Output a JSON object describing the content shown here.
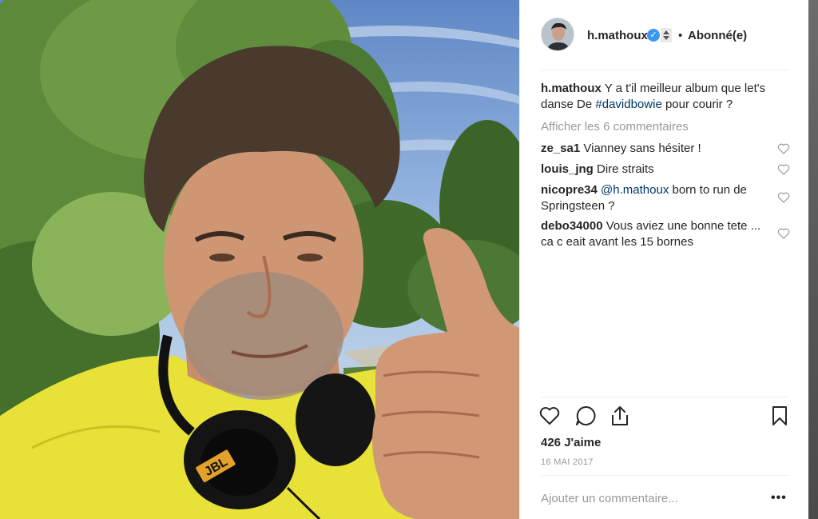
{
  "post": {
    "username": "h.mathoux",
    "verified_mark": "✓",
    "dot": "•",
    "follow_status": "Abonné(e)",
    "caption": {
      "username": "h.mathoux",
      "text_before": " Y a t'il meilleur album que let's danse De ",
      "hashtag": "#davidbowie",
      "text_after": " pour courir ?"
    },
    "view_comments": "Afficher les 6 commentaires",
    "comments": [
      {
        "username": "ze_sa1",
        "text": " Vianney sans hésiter !"
      },
      {
        "username": "louis_jng",
        "text": " Dire straits"
      },
      {
        "username": "nicopre34",
        "mention": "@h.mathoux",
        "text": " born to run de Springsteen ?"
      },
      {
        "username": "debo34000",
        "text": " Vous aviez une bonne tete ... ca c eait avant les 15 bornes"
      }
    ],
    "likes": "426 J'aime",
    "date": "16 MAI 2017",
    "comment_placeholder": "Ajouter un commentaire...",
    "more_options": "•••"
  },
  "icons": {
    "like": "heart-icon",
    "comment": "speech-bubble-icon",
    "share": "share-icon",
    "save": "bookmark-icon",
    "comment_like": "heart-icon",
    "verified": "verified-badge-icon",
    "sort": "sort-arrows-icon"
  },
  "colors": {
    "link": "#003569",
    "verified": "#3897f0",
    "muted": "#999999",
    "text": "#262626"
  }
}
